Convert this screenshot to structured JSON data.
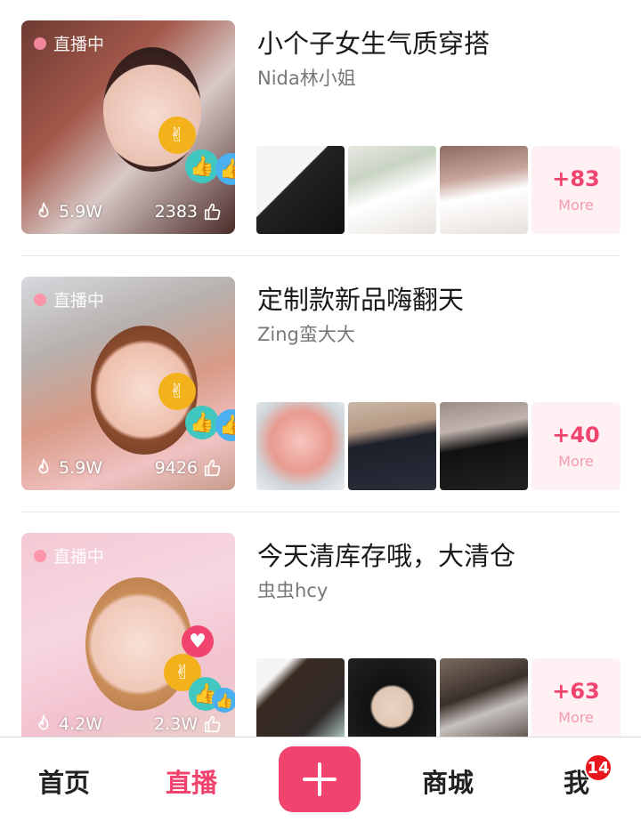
{
  "feed": {
    "cards": [
      {
        "live_label": "直播中",
        "title": "小个子女生气质穿搭",
        "host": "Nida林小姐",
        "views": "5.9W",
        "likes": "2383",
        "more_count": "+83",
        "more_label": "More"
      },
      {
        "live_label": "直播中",
        "title": "定制款新品嗨翻天",
        "host": "Zing蛮大大",
        "views": "5.9W",
        "likes": "9426",
        "more_count": "+40",
        "more_label": "More"
      },
      {
        "live_label": "直播中",
        "title": "今天清库存哦，大清仓",
        "host": "虫虫hcy",
        "views": "4.2W",
        "likes": "2.3W",
        "more_count": "+63",
        "more_label": "More"
      }
    ]
  },
  "tabbar": {
    "home_label": "首页",
    "live_label": "直播",
    "mall_label": "商城",
    "me_label": "我",
    "me_badge": "14",
    "active_tab": "直播"
  },
  "colors": {
    "accent": "#f0446f",
    "more_bg": "#fff0f3",
    "badge": "#e8161c"
  },
  "icons": [
    "fire-icon",
    "thumbs-up-icon",
    "plus-icon",
    "victory-hand-icon",
    "heart-icon"
  ]
}
